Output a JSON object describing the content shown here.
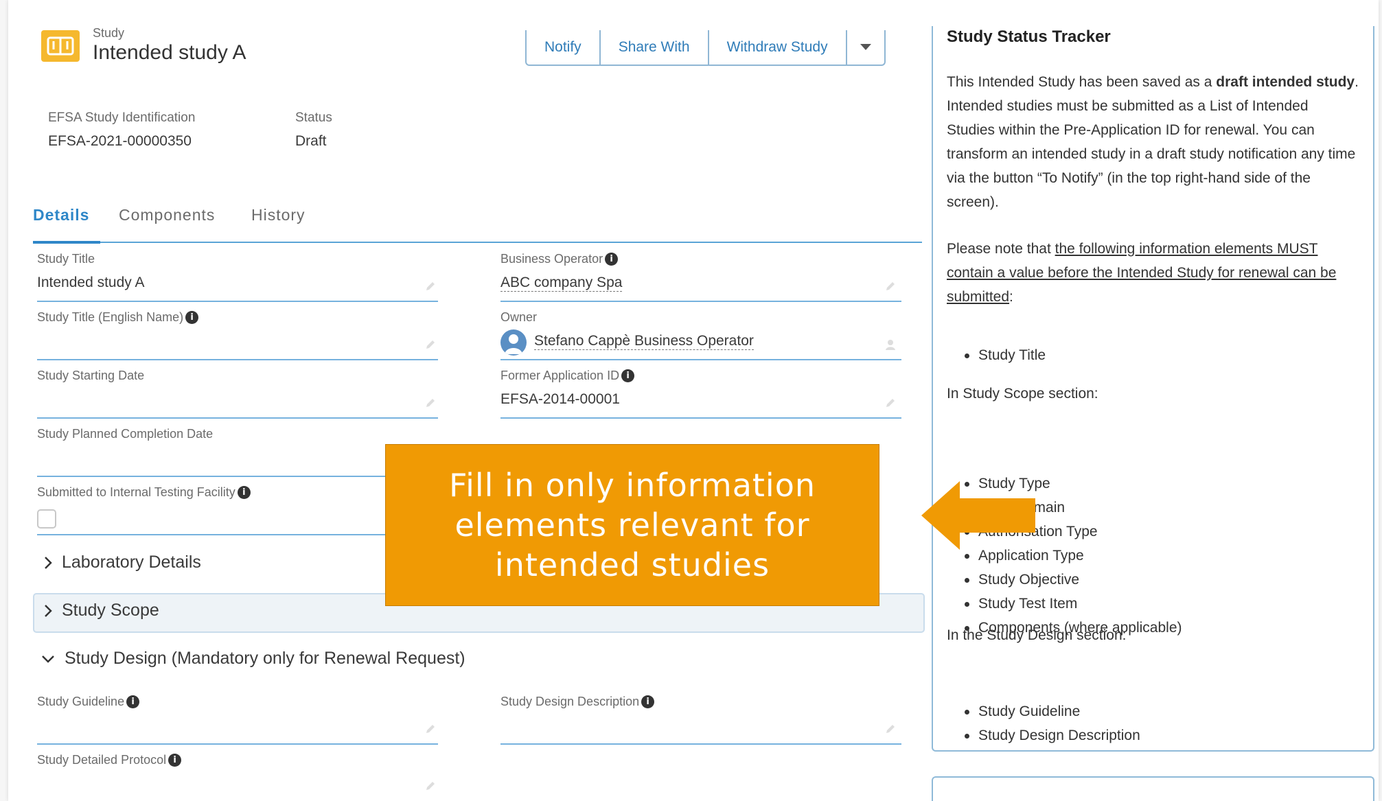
{
  "header": {
    "eyebrow": "Study",
    "title": "Intended study A",
    "actions": [
      "Notify",
      "Share With",
      "Withdraw Study"
    ]
  },
  "meta": {
    "id_label": "EFSA Study Identification",
    "id_value": "EFSA-2021-00000350",
    "status_label": "Status",
    "status_value": "Draft"
  },
  "tabs": [
    "Details",
    "Components",
    "History"
  ],
  "fields": {
    "study_title": {
      "label": "Study Title",
      "value": "Intended study A"
    },
    "business_operator": {
      "label": "Business Operator",
      "value": "ABC company Spa"
    },
    "study_title_en": {
      "label": "Study Title (English Name)",
      "value": ""
    },
    "owner": {
      "label": "Owner",
      "value": "Stefano Cappè Business Operator"
    },
    "start_date": {
      "label": "Study Starting Date",
      "value": ""
    },
    "former_app_id": {
      "label": "Former Application ID",
      "value": "EFSA-2014-00001"
    },
    "completion_date": {
      "label": "Study Planned Completion Date",
      "value": ""
    },
    "submitted_itf": {
      "label": "Submitted to Internal Testing Facility",
      "value": ""
    },
    "study_guideline": {
      "label": "Study Guideline",
      "value": ""
    },
    "study_design_desc": {
      "label": "Study Design Description",
      "value": ""
    },
    "study_protocol": {
      "label": "Study Detailed Protocol",
      "value": ""
    }
  },
  "sections": {
    "laboratory": "Laboratory Details",
    "scope": "Study Scope",
    "design": "Study Design (Mandatory only for Renewal Request)"
  },
  "tracker": {
    "title": "Study Status Tracker",
    "p1_a": "This Intended Study has been saved as a ",
    "p1_bold": "draft intended study",
    "p1_b": ". Intended studies must be submitted as a List of Intended Studies within the Pre-Application ID for renewal. You can transform an intended study in a draft study notification any time via the button “To Notify” (in the top right-hand side of the screen).",
    "p2_a": "Please note that ",
    "p2_link": "the following information elements MUST contain a value before the Intended Study for renewal can be submitted",
    "p2_b": ":",
    "list1": [
      "Study Title"
    ],
    "scope_heading": "In Study Scope section:",
    "list2": [
      "Study Type",
      "Food Domain",
      "Authorisation Type",
      "Application Type",
      "Study Objective",
      "Study Test Item",
      "Components (where applicable)"
    ],
    "design_heading": "In the Study Design section:",
    "list3": [
      "Study Guideline",
      "Study Design Description"
    ]
  },
  "callout": {
    "text": "Fill in only information elements relevant for intended studies",
    "color": "#f09a04"
  },
  "colors": {
    "accent": "#2f87c8",
    "icon": "#f5b82e"
  }
}
